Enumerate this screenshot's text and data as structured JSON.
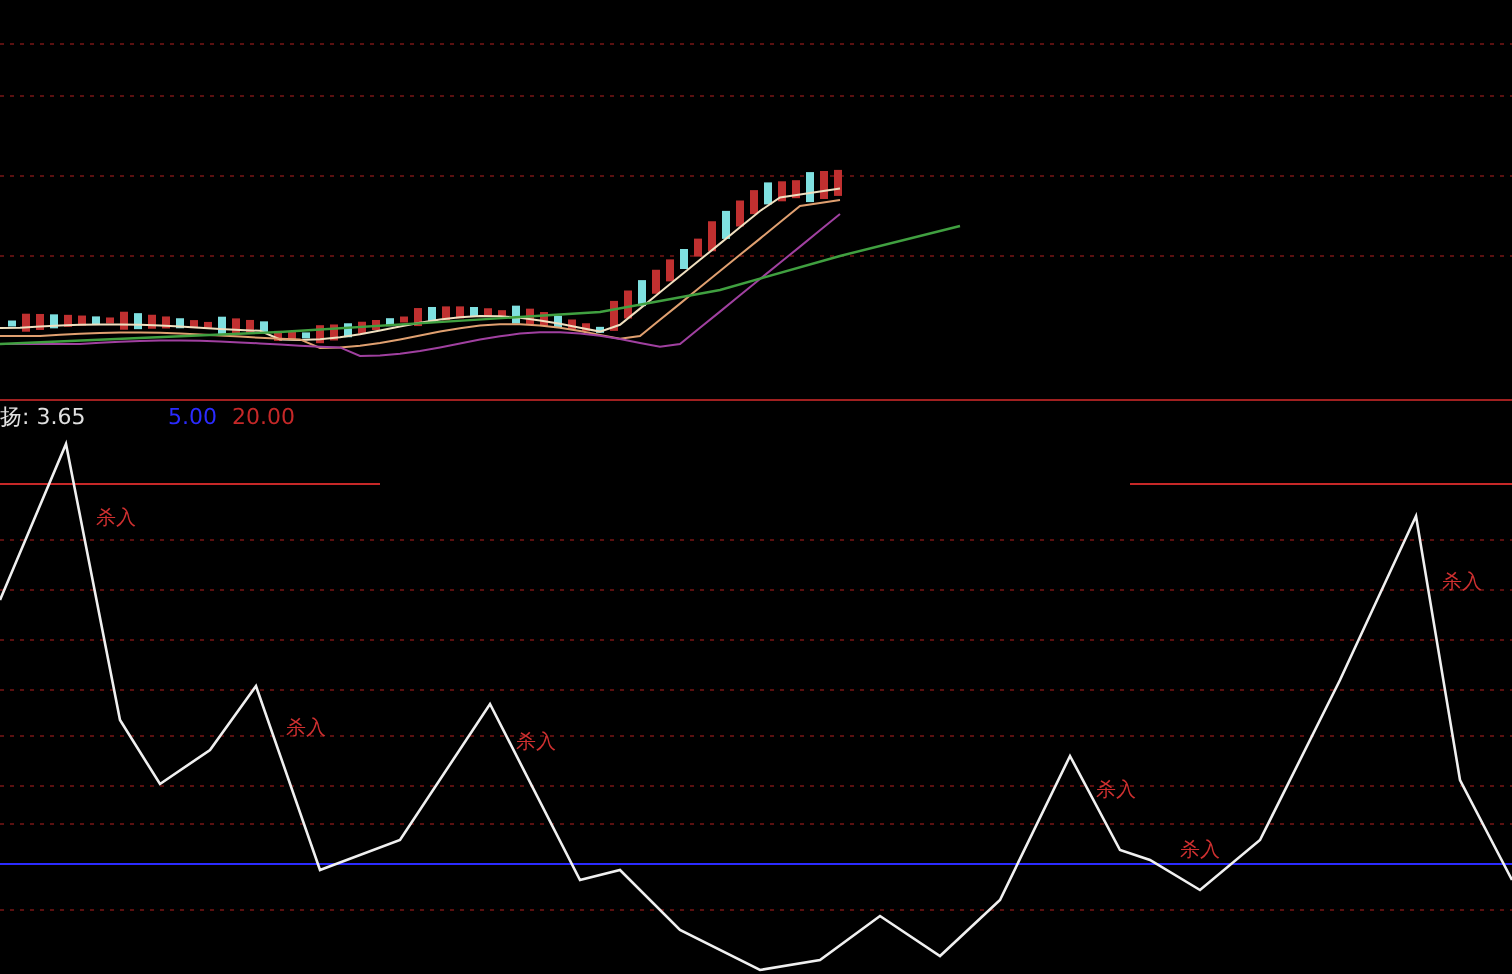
{
  "indicator_header": {
    "name_value": "扬: 3.65",
    "levels": [
      {
        "text": "5.00",
        "color": "#2b2bff"
      },
      {
        "text": "20.00",
        "color": "#c62828"
      }
    ]
  },
  "signals": [
    {
      "label": "杀入"
    },
    {
      "label": "杀入"
    },
    {
      "label": "杀入"
    },
    {
      "label": "杀入"
    },
    {
      "label": "杀入"
    },
    {
      "label": "杀入"
    }
  ]
}
